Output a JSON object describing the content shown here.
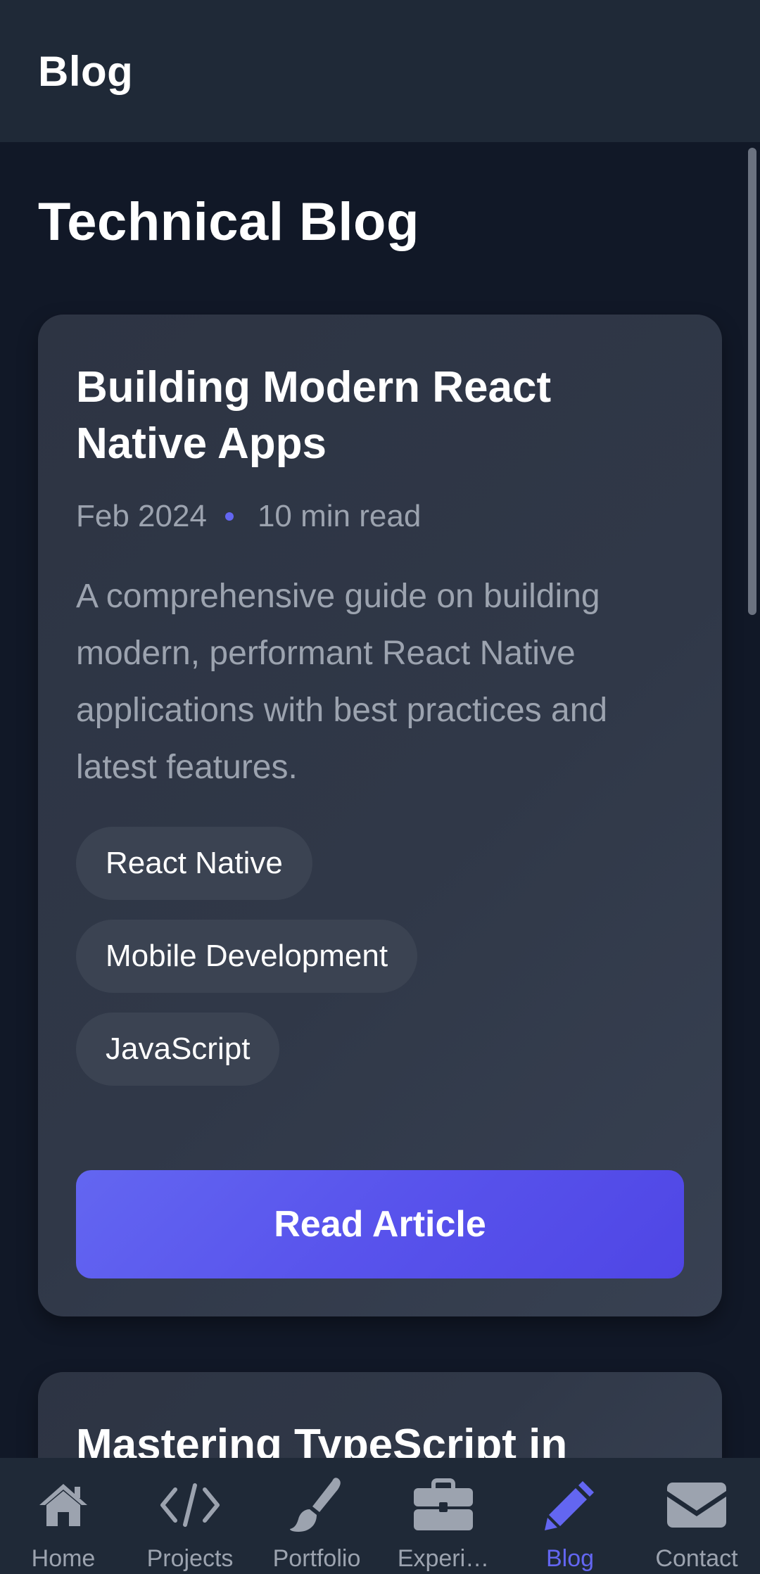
{
  "header": {
    "title": "Blog"
  },
  "page": {
    "title": "Technical Blog"
  },
  "posts": [
    {
      "title": "Building Modern React Native Apps",
      "date": "Feb 2024",
      "read_time": "10 min read",
      "description": "A comprehensive guide on building modern, performant React Native applications with best practices and latest features.",
      "tags": [
        "React Native",
        "Mobile Development",
        "JavaScript"
      ],
      "button_label": "Read Article"
    },
    {
      "title": "Mastering TypeScript in"
    }
  ],
  "nav": {
    "items": [
      {
        "label": "Home",
        "icon": "home-icon"
      },
      {
        "label": "Projects",
        "icon": "code-icon"
      },
      {
        "label": "Portfolio",
        "icon": "paintbrush-icon"
      },
      {
        "label": "Experi…",
        "icon": "briefcase-icon"
      },
      {
        "label": "Blog",
        "icon": "pencil-icon"
      },
      {
        "label": "Contact",
        "icon": "envelope-icon"
      }
    ],
    "active": "Blog"
  },
  "colors": {
    "accent": "#6366f1",
    "background": "#111827",
    "surface": "#1f2937",
    "card": "#303848",
    "muted_text": "#9ca3af"
  }
}
